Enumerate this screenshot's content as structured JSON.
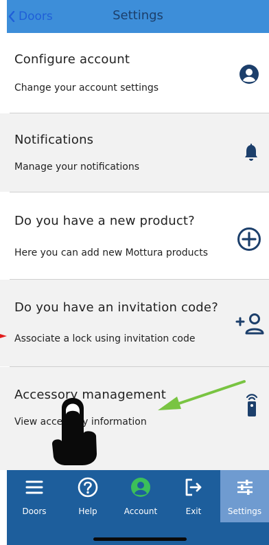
{
  "header": {
    "back_label": "Doors",
    "title": "Settings"
  },
  "items": [
    {
      "title": "Configure account",
      "subtitle": "Change your account settings",
      "icon": "user-circle-icon"
    },
    {
      "title": "Notifications",
      "subtitle": "Manage your notifications",
      "icon": "bell-icon"
    },
    {
      "title": "Do you have a new product?",
      "subtitle": "Here you can add new Mottura products",
      "icon": "plus-circle-icon"
    },
    {
      "title": "Do you have an invitation code?",
      "subtitle": "Associate a lock using invitation code",
      "icon": "add-user-icon"
    },
    {
      "title": "Accessory management",
      "subtitle": "View accessory information",
      "icon": "remote-control-icon"
    }
  ],
  "tabs": [
    {
      "label": "Doors",
      "icon": "hamburger-icon"
    },
    {
      "label": "Help",
      "icon": "help-circle-icon"
    },
    {
      "label": "Account",
      "icon": "user-circle-icon",
      "color": "#3bbf5a"
    },
    {
      "label": "Exit",
      "icon": "exit-icon"
    },
    {
      "label": "Settings",
      "icon": "sliders-icon",
      "selected": true
    }
  ],
  "colors": {
    "header_bg": "#3d8ed9",
    "tabbar_bg": "#1d5e9c",
    "tab_active_bg": "#6f9bd0",
    "accent_green": "#3bbf5a",
    "annotation_arrow": "#79c442"
  }
}
